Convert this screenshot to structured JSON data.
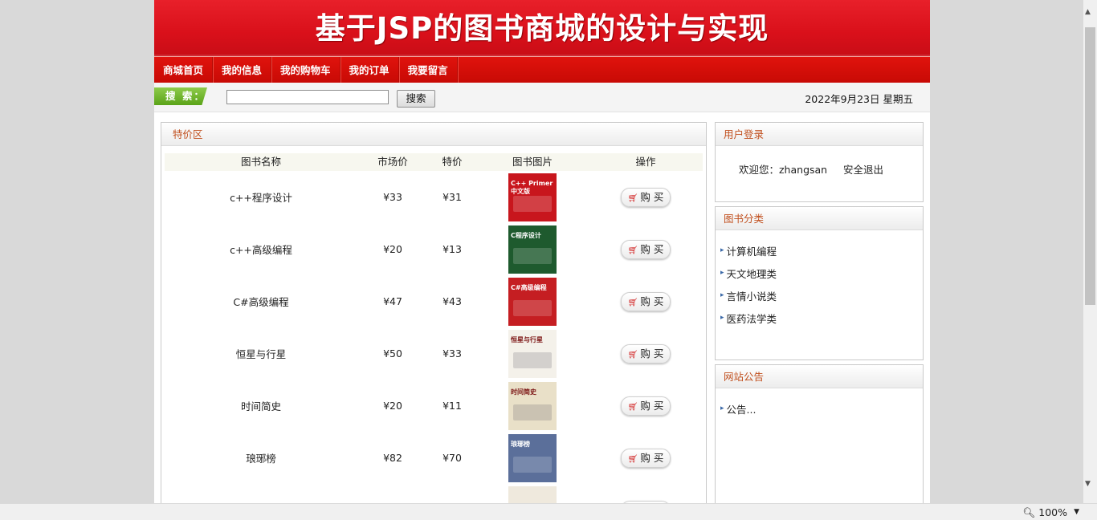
{
  "banner": {
    "title": "基于JSP的图书商城的设计与实现"
  },
  "nav": {
    "items": [
      "商城首页",
      "我的信息",
      "我的购物车",
      "我的订单",
      "我要留言"
    ]
  },
  "search": {
    "tag": "搜 索：",
    "value": "",
    "button": "搜索",
    "date": "2022年9月23日 星期五"
  },
  "main": {
    "title": "特价区",
    "headers": [
      "图书名称",
      "市场价",
      "特价",
      "图书图片",
      "操作"
    ],
    "buy_label": "购 买",
    "rows": [
      {
        "name": "c++程序设计",
        "market": "¥33",
        "special": "¥31",
        "cover_text": "C++ Primer中文版",
        "cover_color": "#c8161d"
      },
      {
        "name": "c++高级编程",
        "market": "¥20",
        "special": "¥13",
        "cover_text": "C程序设计",
        "cover_color": "#1e5a2e"
      },
      {
        "name": "C#高级编程",
        "market": "¥47",
        "special": "¥43",
        "cover_text": "C#高级编程",
        "cover_color": "#c51e22"
      },
      {
        "name": "恒星与行星",
        "market": "¥50",
        "special": "¥33",
        "cover_text": "恒星与行星",
        "cover_color": "#f4f1ea"
      },
      {
        "name": "时间简史",
        "market": "¥20",
        "special": "¥11",
        "cover_text": "时间简史",
        "cover_color": "#e9e0c8"
      },
      {
        "name": "琅琊榜",
        "market": "¥82",
        "special": "¥70",
        "cover_text": "琅琊榜",
        "cover_color": "#5b6f9a"
      },
      {
        "name": "",
        "market": "",
        "special": "",
        "cover_text": "",
        "cover_color": "#efe9dd"
      }
    ]
  },
  "login": {
    "title": "用户登录",
    "welcome": "欢迎您：zhangsan",
    "logout": "安全退出"
  },
  "categories": {
    "title": "图书分类",
    "items": [
      "计算机编程",
      "天文地理类",
      "言情小说类",
      "医药法学类"
    ]
  },
  "notice": {
    "title": "网站公告",
    "items": [
      "公告..."
    ]
  },
  "statusbar": {
    "zoom": "100%"
  }
}
